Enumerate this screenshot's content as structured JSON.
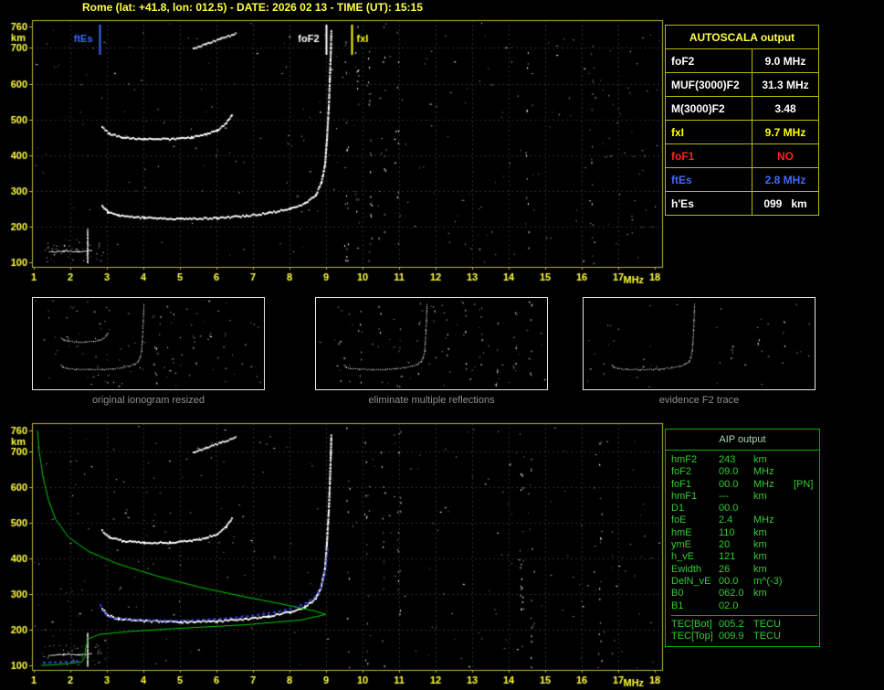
{
  "title": "Rome (lat: +41.8, lon: 012.5) - DATE: 2026 02 13 - TIME (UT): 15:15",
  "colors": {
    "background": "#000000",
    "axis_yellow": "#ffff44",
    "plot_border": "#b9b93a",
    "table_border_yellow": "#b9b900",
    "table_border_green": "#00b000",
    "aip_text_green": "#33cc33",
    "marker_blue": "#3a6bff",
    "marker_yellow": "#ffff00",
    "alert_red": "#ff2222",
    "profile_green": "#00cc00",
    "fit_blue": "#3344ee"
  },
  "autoscala_table": {
    "header": "AUTOSCALA output",
    "rows": [
      {
        "label": "foF2",
        "value": "9.0 MHz",
        "color": "#ffffff"
      },
      {
        "label": "MUF(3000)F2",
        "value": "31.3 MHz",
        "color": "#ffffff"
      },
      {
        "label": "M(3000)F2",
        "value": "3.48",
        "color": "#ffffff"
      },
      {
        "label": "fxI",
        "value": "9.7 MHz",
        "color": "#ffff00"
      },
      {
        "label": "foF1",
        "value": "NO",
        "color": "#ff2222"
      },
      {
        "label": "ftEs",
        "value": "2.8 MHz",
        "color": "#4169ff"
      },
      {
        "label": "h'Es",
        "value": "099   km",
        "color": "#ffffff"
      }
    ]
  },
  "thumbnails": [
    {
      "caption": "original ionogram resized"
    },
    {
      "caption": "eliminate multiple reflections"
    },
    {
      "caption": "evidence F2 trace"
    }
  ],
  "aip_table": {
    "header": "AIP output",
    "rows": [
      {
        "label": "hmF2",
        "value": "243",
        "unit": "km",
        "note": ""
      },
      {
        "label": "foF2",
        "value": "09.0",
        "unit": "MHz",
        "note": ""
      },
      {
        "label": "foF1",
        "value": "00.0",
        "unit": "MHz",
        "note": "[PN]"
      },
      {
        "label": "hmF1",
        "value": "---",
        "unit": "km",
        "note": ""
      },
      {
        "label": "D1",
        "value": "00.0",
        "unit": "",
        "note": ""
      },
      {
        "label": "foE",
        "value": "2.4",
        "unit": "MHz",
        "note": ""
      },
      {
        "label": "hmE",
        "value": "110",
        "unit": "km",
        "note": ""
      },
      {
        "label": "ymE",
        "value": "20",
        "unit": "km",
        "note": ""
      },
      {
        "label": "h_vE",
        "value": "121",
        "unit": "km",
        "note": ""
      },
      {
        "label": "Ewidth",
        "value": "26",
        "unit": "km",
        "note": ""
      },
      {
        "label": "DelN_vE",
        "value": "00.0",
        "unit": "m^(-3)",
        "note": ""
      },
      {
        "label": "B0",
        "value": "062.0",
        "unit": "km",
        "note": ""
      },
      {
        "label": "B1",
        "value": "02.0",
        "unit": "",
        "note": ""
      }
    ],
    "tec_rows": [
      {
        "label": "TEC[Bot]",
        "value": "005.2",
        "unit": "TECU",
        "note": ""
      },
      {
        "label": "TEC[Top]",
        "value": "009.9",
        "unit": "TECU",
        "note": ""
      }
    ]
  },
  "chart_data": {
    "type": "scatter",
    "title": "Rome (lat: +41.8, lon: 012.5) - DATE: 2026 02 13 - TIME (UT): 15:15",
    "x_unit": "MHz",
    "y_unit": "km",
    "xlim": [
      1,
      18
    ],
    "ylim": [
      100,
      760
    ],
    "x_ticks": [
      1,
      2,
      3,
      4,
      5,
      6,
      7,
      8,
      9,
      10,
      11,
      12,
      13,
      14,
      15,
      16,
      17,
      18
    ],
    "y_ticks": [
      760,
      700,
      600,
      500,
      400,
      300,
      200,
      100
    ],
    "grid": true,
    "markers": [
      {
        "label": "ftEs",
        "freq": 2.8,
        "color": "#3a6bff",
        "side": "left"
      },
      {
        "label": "foF2",
        "freq": 9.0,
        "color": "#ffffff",
        "side": "left"
      },
      {
        "label": "fxI",
        "freq": 9.7,
        "color": "#ffff00",
        "side": "right"
      }
    ],
    "traces": {
      "f2_echo": [
        [
          2.85,
          262
        ],
        [
          3.0,
          243
        ],
        [
          3.3,
          233
        ],
        [
          4.0,
          227
        ],
        [
          5.0,
          224
        ],
        [
          6.0,
          226
        ],
        [
          6.8,
          232
        ],
        [
          7.4,
          240
        ],
        [
          8.0,
          252
        ],
        [
          8.4,
          266
        ],
        [
          8.7,
          290
        ],
        [
          8.85,
          325
        ],
        [
          8.95,
          375
        ],
        [
          9.0,
          445
        ],
        [
          9.05,
          535
        ],
        [
          9.08,
          615
        ],
        [
          9.11,
          700
        ],
        [
          9.12,
          748
        ]
      ],
      "f2_second_hop": [
        [
          2.85,
          480
        ],
        [
          3.05,
          462
        ],
        [
          3.4,
          452
        ],
        [
          4.0,
          447
        ],
        [
          4.7,
          447
        ],
        [
          5.3,
          452
        ],
        [
          5.7,
          460
        ],
        [
          6.0,
          472
        ],
        [
          6.25,
          492
        ],
        [
          6.4,
          515
        ]
      ],
      "top_arc": [
        [
          5.35,
          700
        ],
        [
          5.7,
          714
        ],
        [
          6.1,
          728
        ],
        [
          6.5,
          742
        ]
      ],
      "es_trace": [
        [
          1.45,
          130
        ],
        [
          1.8,
          132
        ],
        [
          2.2,
          131
        ],
        [
          2.55,
          133
        ]
      ],
      "es_vertical": [
        [
          2.45,
          192
        ],
        [
          2.45,
          102
        ]
      ],
      "green_profile": [
        [
          1.1,
          760
        ],
        [
          1.15,
          700
        ],
        [
          1.25,
          630
        ],
        [
          1.4,
          565
        ],
        [
          1.6,
          510
        ],
        [
          1.95,
          460
        ],
        [
          2.5,
          420
        ],
        [
          3.3,
          385
        ],
        [
          4.4,
          350
        ],
        [
          5.6,
          318
        ],
        [
          6.9,
          290
        ],
        [
          8.0,
          268
        ],
        [
          8.7,
          252
        ],
        [
          9.0,
          243
        ],
        [
          8.3,
          227
        ],
        [
          6.8,
          214
        ],
        [
          5.0,
          204
        ],
        [
          3.6,
          195
        ],
        [
          2.8,
          187
        ],
        [
          2.5,
          175
        ],
        [
          2.42,
          150
        ],
        [
          2.4,
          125
        ],
        [
          2.32,
          110
        ],
        [
          1.95,
          105
        ],
        [
          1.5,
          101
        ],
        [
          1.2,
          100
        ]
      ],
      "blue_fit": [
        [
          2.82,
          272
        ],
        [
          2.9,
          248
        ],
        [
          3.1,
          235
        ],
        [
          3.6,
          229
        ],
        [
          4.4,
          226
        ],
        [
          5.2,
          226
        ],
        [
          6.0,
          230
        ],
        [
          6.8,
          237
        ],
        [
          7.5,
          247
        ],
        [
          8.0,
          258
        ],
        [
          8.4,
          272
        ],
        [
          8.7,
          292
        ],
        [
          8.9,
          325
        ],
        [
          9.0,
          380
        ],
        [
          9.05,
          428
        ]
      ],
      "blue_es": [
        [
          1.25,
          107
        ],
        [
          2.3,
          112
        ]
      ]
    }
  }
}
